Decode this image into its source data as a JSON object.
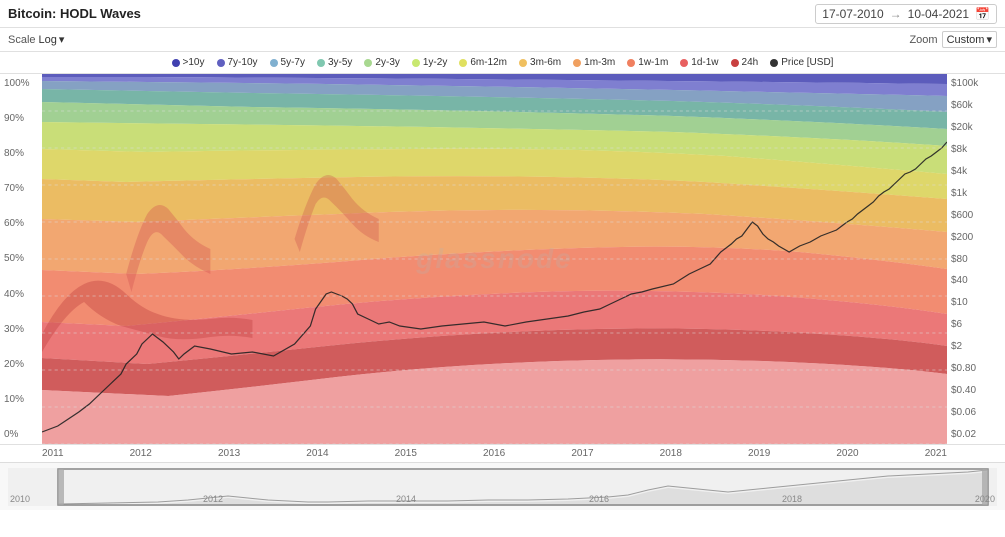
{
  "header": {
    "title": "Bitcoin: HODL Waves",
    "date_start": "17-07-2010",
    "date_end": "10-04-2021",
    "date_separator": "→"
  },
  "controls": {
    "scale_label": "Scale",
    "scale_value": "Log",
    "zoom_label": "Zoom",
    "zoom_value": "Custom"
  },
  "legend": [
    {
      "key": "gt10y",
      "label": ">10y",
      "color": "#4040b0"
    },
    {
      "key": "7y10y",
      "label": "7y-10y",
      "color": "#6060c0"
    },
    {
      "key": "5y7y",
      "label": "5y-7y",
      "color": "#80b0d0"
    },
    {
      "key": "3y5y",
      "label": "3y-5y",
      "color": "#80c8b0"
    },
    {
      "key": "2y3y",
      "label": "2y-3y",
      "color": "#a8d890"
    },
    {
      "key": "1y2y",
      "label": "1y-2y",
      "color": "#c8e870"
    },
    {
      "key": "6m12m",
      "label": "6m-12m",
      "color": "#e0e060"
    },
    {
      "key": "3m6m",
      "label": "3m-6m",
      "color": "#f0c060"
    },
    {
      "key": "1m3m",
      "label": "1m-3m",
      "color": "#f0a060"
    },
    {
      "key": "1w1m",
      "label": "1w-1m",
      "color": "#f08060"
    },
    {
      "key": "1d1w",
      "label": "1d-1w",
      "color": "#e86060"
    },
    {
      "key": "24h",
      "label": "24h",
      "color": "#c84040"
    },
    {
      "key": "price",
      "label": "Price [USD]",
      "color": "#333333"
    }
  ],
  "y_axis_left": [
    "100%",
    "90%",
    "80%",
    "70%",
    "60%",
    "50%",
    "40%",
    "30%",
    "20%",
    "10%",
    "0%"
  ],
  "y_axis_right": [
    "$100k",
    "$60k",
    "$20k",
    "$8k",
    "$4k",
    "$1k",
    "$600",
    "$200",
    "$80",
    "$40",
    "$10",
    "$6",
    "$2",
    "$0.80",
    "$0.40",
    "$0.06",
    "$0.02"
  ],
  "x_axis": [
    "2011",
    "2012",
    "2013",
    "2014",
    "2015",
    "2016",
    "2017",
    "2018",
    "2019",
    "2020",
    "2021"
  ],
  "minimap_labels": [
    "2010",
    "2012",
    "2014",
    "2016",
    "2018",
    "2020"
  ],
  "watermark": "glassnode"
}
